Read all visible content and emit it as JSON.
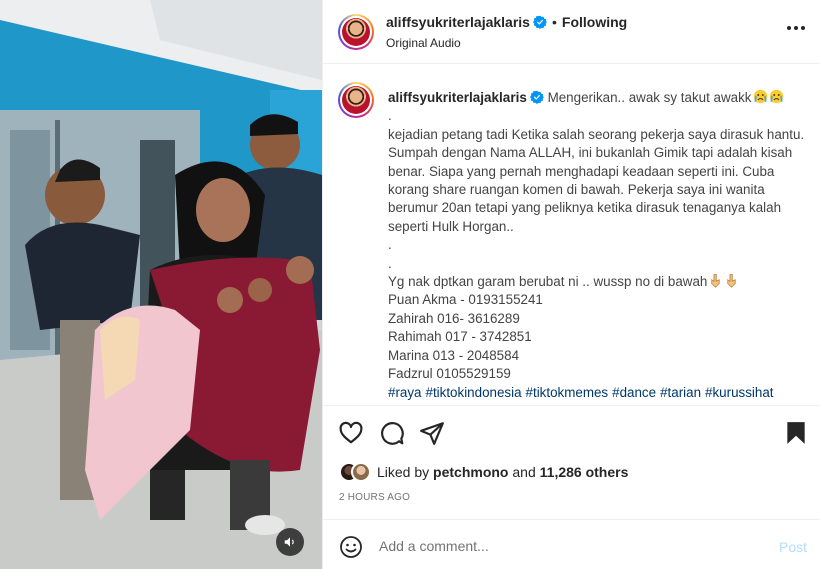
{
  "post": {
    "username": "aliffsyukriterlajaklaris",
    "follow_status": "Following",
    "audio": "Original Audio",
    "separator": "•"
  },
  "caption": {
    "username": "aliffsyukriterlajaklaris",
    "headline": "Mengerikan.. awak sy takut awakk",
    "dot1": ".",
    "paragraph": "kejadian petang tadi Ketika salah seorang pekerja saya dirasuk hantu. Sumpah dengan Nama ALLAH, ini bukanlah Gimik tapi adalah kisah benar. Siapa yang pernah menghadapi keadaan seperti ini. Cuba korang share ruangan komen di bawah. Pekerja saya ini wanita berumur 20an tetapi yang peliknya ketika dirasuk tenaganya kalah seperti Hulk Horgan..",
    "dot2": ".",
    "dot3": ".",
    "contact_intro": "Yg nak dptkan garam berubat ni .. wussp no di bawah",
    "contacts": [
      "Puan Akma - 0193155241",
      "Zahirah 016- 3616289",
      "Rahimah 017 - 3742851",
      "Marina 013 - 2048584",
      "Fadzrul 0105529159"
    ],
    "hashtags": [
      "#raya",
      "#tiktokindonesia",
      "#tiktokmemes",
      "#dance",
      "#tarian",
      "#kurussihat"
    ]
  },
  "likes": {
    "prefix": "Liked by",
    "user": "petchmono",
    "conjunction": "and",
    "count": "11,286 others"
  },
  "timestamp": "2 HOURS AGO",
  "comment": {
    "placeholder": "Add a comment...",
    "post_label": "Post"
  },
  "icons": {
    "verified": "verified-badge-icon",
    "more": "more-options-icon",
    "like": "heart-icon",
    "comment": "comment-icon",
    "share": "paper-plane-icon",
    "save": "bookmark-icon",
    "emoji": "smile-icon",
    "mute": "speaker-icon",
    "crying": "crying-face-emoji",
    "pointing": "pointing-down-emoji"
  },
  "colors": {
    "verified": "#0095f6",
    "hashtag": "#00376b",
    "post_disabled": "#b3dbff",
    "muted_text": "#737373"
  }
}
